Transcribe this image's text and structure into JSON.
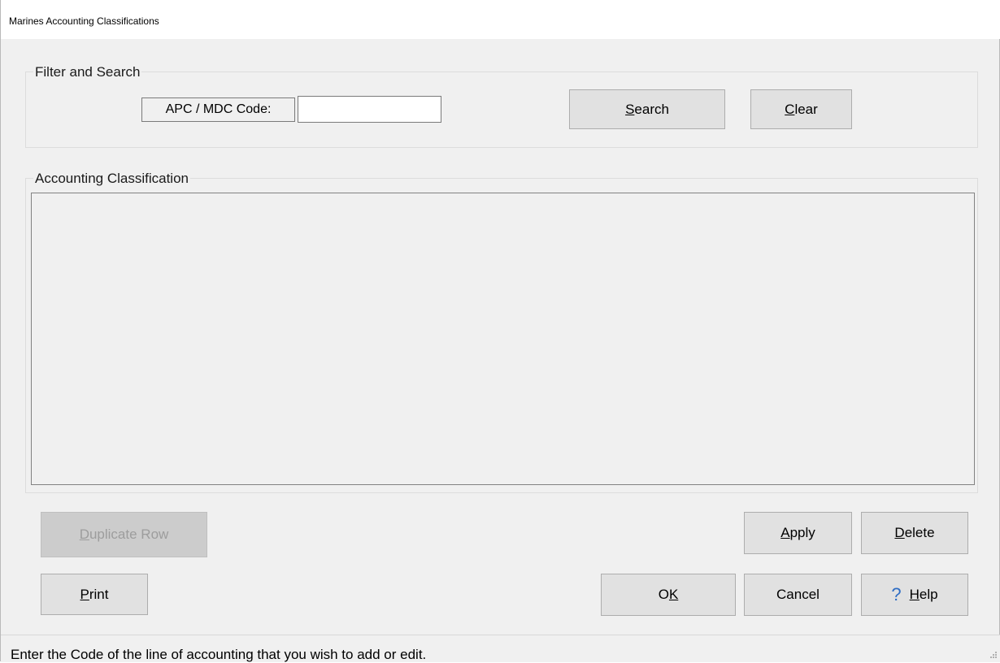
{
  "window": {
    "title": "Marines Accounting Classifications"
  },
  "filter": {
    "group_title": "Filter and Search",
    "code_label": "APC / MDC Code:",
    "code_value": "",
    "search_button": {
      "pre": "",
      "key": "S",
      "post": "earch"
    },
    "clear_button": {
      "pre": "",
      "key": "C",
      "post": "lear"
    }
  },
  "accounting": {
    "group_title": "Accounting Classification",
    "rows": []
  },
  "actions": {
    "duplicate_row": {
      "pre": "",
      "key": "D",
      "post": "uplicate Row",
      "enabled": false
    },
    "apply": {
      "pre": "",
      "key": "A",
      "post": "pply"
    },
    "delete": {
      "pre": "",
      "key": "D",
      "post": "elete"
    },
    "print": {
      "pre": "",
      "key": "P",
      "post": "rint"
    },
    "ok": {
      "pre": "O",
      "key": "K",
      "post": ""
    },
    "cancel": {
      "label": "Cancel"
    },
    "help": {
      "icon": "help-question-icon",
      "glyph": "?",
      "pre": "",
      "key": "H",
      "post": "elp"
    }
  },
  "status": {
    "text": "Enter the Code of the line of accounting that you wish to add or edit."
  },
  "colors": {
    "window_bg": "#f0f0f0",
    "button_bg": "#e1e1e1",
    "help_icon": "#2e6dc4"
  }
}
